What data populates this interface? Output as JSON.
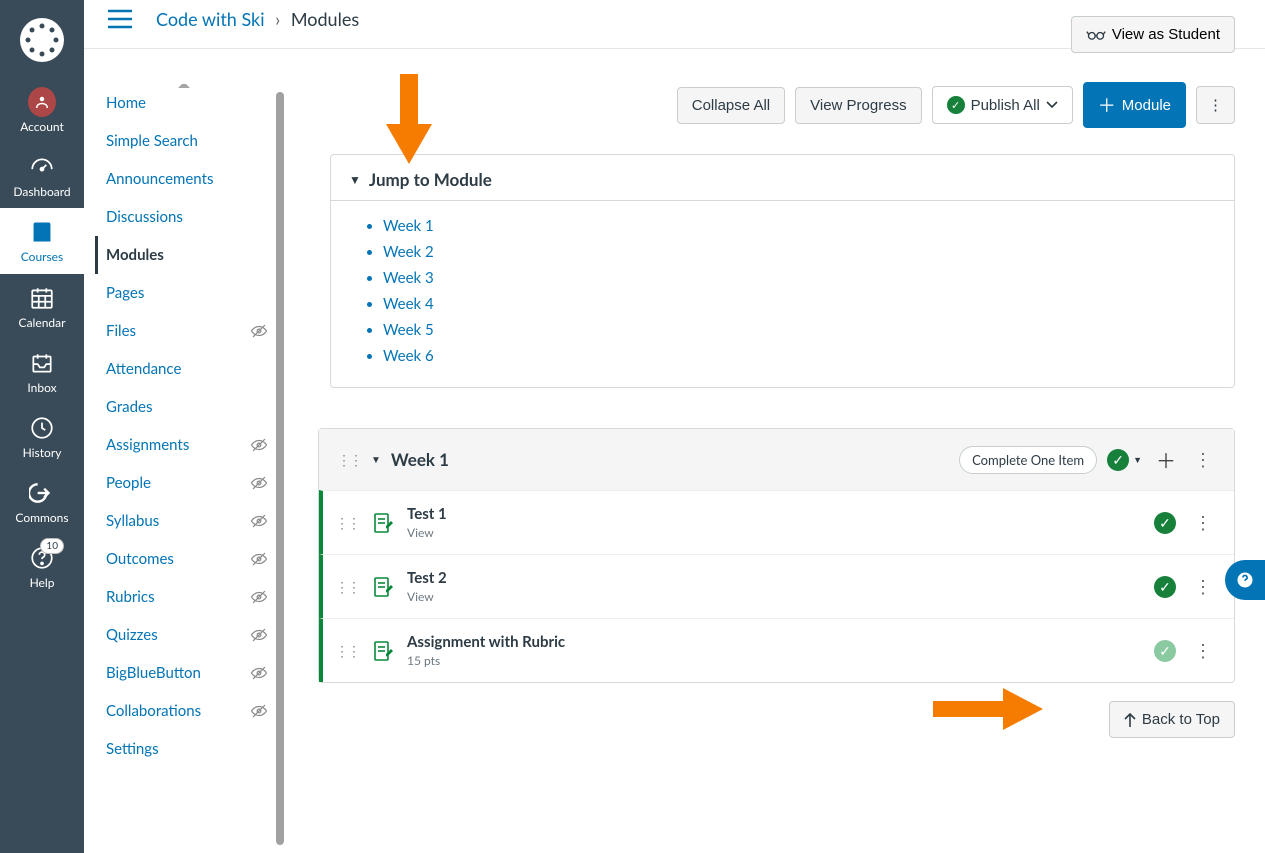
{
  "breadcrumb": {
    "course": "Code with Ski",
    "page": "Modules"
  },
  "view_as_student": "View as Student",
  "global_nav": [
    {
      "key": "account",
      "label": "Account"
    },
    {
      "key": "dashboard",
      "label": "Dashboard"
    },
    {
      "key": "courses",
      "label": "Courses",
      "active": true
    },
    {
      "key": "calendar",
      "label": "Calendar"
    },
    {
      "key": "inbox",
      "label": "Inbox"
    },
    {
      "key": "history",
      "label": "History"
    },
    {
      "key": "commons",
      "label": "Commons"
    },
    {
      "key": "help",
      "label": "Help",
      "badge": "10"
    }
  ],
  "course_nav": [
    {
      "label": "Home"
    },
    {
      "label": "Simple Search"
    },
    {
      "label": "Announcements"
    },
    {
      "label": "Discussions"
    },
    {
      "label": "Modules",
      "active": true
    },
    {
      "label": "Pages"
    },
    {
      "label": "Files",
      "hidden": true
    },
    {
      "label": "Attendance"
    },
    {
      "label": "Grades"
    },
    {
      "label": "Assignments",
      "hidden": true
    },
    {
      "label": "People",
      "hidden": true
    },
    {
      "label": "Syllabus",
      "hidden": true
    },
    {
      "label": "Outcomes",
      "hidden": true
    },
    {
      "label": "Rubrics",
      "hidden": true
    },
    {
      "label": "Quizzes",
      "hidden": true
    },
    {
      "label": "BigBlueButton",
      "hidden": true
    },
    {
      "label": "Collaborations",
      "hidden": true
    },
    {
      "label": "Settings"
    }
  ],
  "actions": {
    "collapse_all": "Collapse All",
    "view_progress": "View Progress",
    "publish_all": "Publish All",
    "add_module": "Module",
    "back_to_top": "Back to Top"
  },
  "jump": {
    "title": "Jump to Module",
    "items": [
      "Week 1",
      "Week 2",
      "Week 3",
      "Week 4",
      "Week 5",
      "Week 6"
    ]
  },
  "module": {
    "title": "Week 1",
    "requirement": "Complete One Item",
    "items": [
      {
        "title": "Test 1",
        "sub": "View",
        "published": true
      },
      {
        "title": "Test 2",
        "sub": "View",
        "published": true
      },
      {
        "title": "Assignment with Rubric",
        "sub": "15 pts",
        "published": false
      }
    ]
  }
}
